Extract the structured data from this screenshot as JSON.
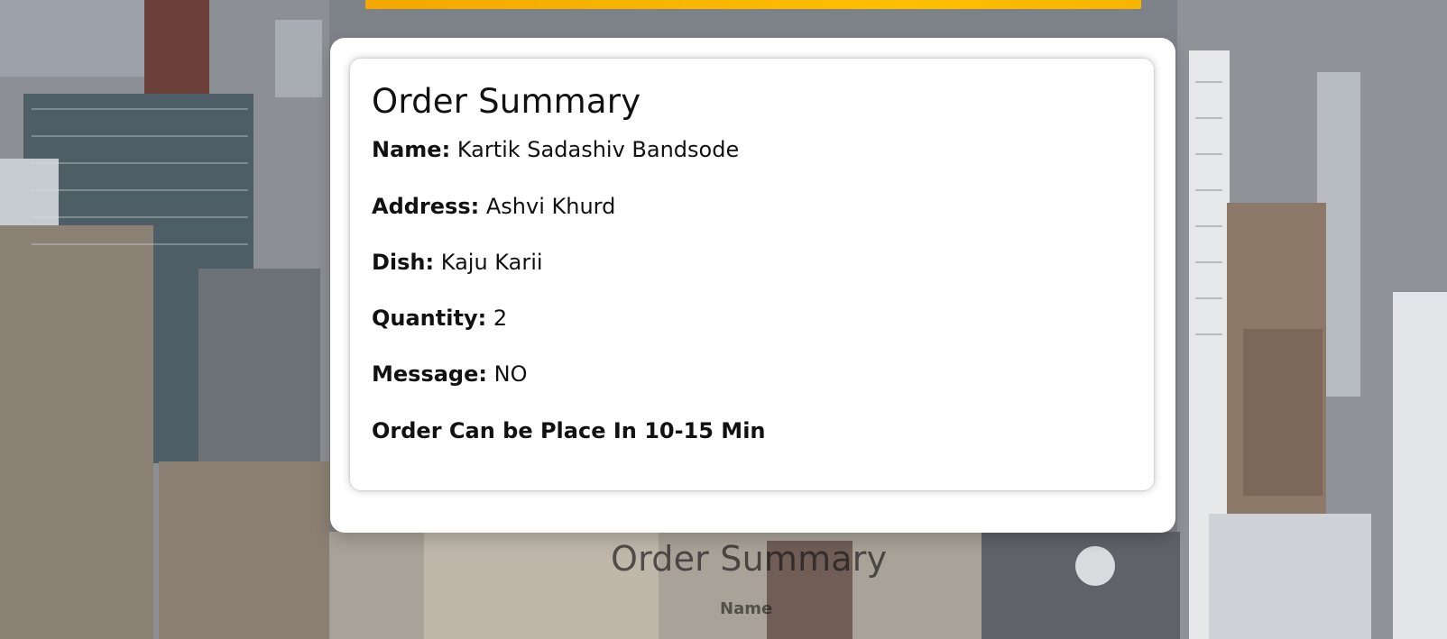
{
  "summary": {
    "title": "Order Summary",
    "name_label": "Name:",
    "name_value": "Kartik Sadashiv Bandsode",
    "address_label": "Address:",
    "address_value": "Ashvi Khurd",
    "dish_label": "Dish:",
    "dish_value": "Kaju Karii",
    "quantity_label": "Quantity:",
    "quantity_value": "2",
    "message_label": "Message:",
    "message_value": "NO",
    "eta_text": "Order Can be Place In 10-15 Min"
  },
  "background_overlay": {
    "title": "Order Summary",
    "name_label": "Name"
  },
  "colors": {
    "accent": "#f7b400",
    "card": "#ffffff",
    "text": "#111111"
  }
}
